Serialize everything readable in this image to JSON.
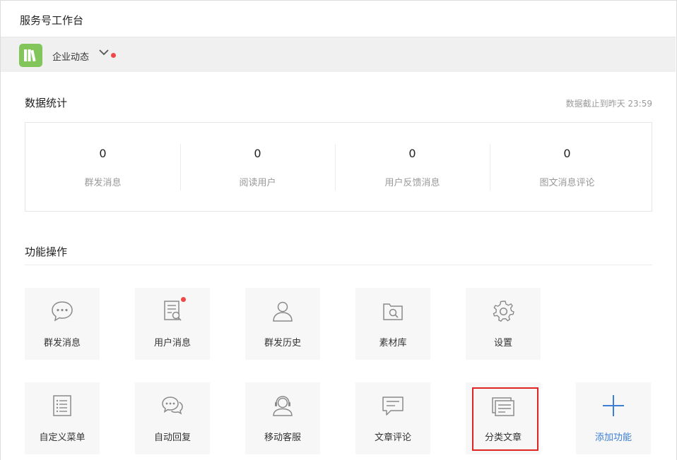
{
  "header": {
    "title": "服务号工作台"
  },
  "account": {
    "name": "企业动态",
    "brand_color": "#82c55b"
  },
  "stats": {
    "title": "数据统计",
    "note": "数据截止到昨天 23:59",
    "items": [
      {
        "value": "0",
        "label": "群发消息"
      },
      {
        "value": "0",
        "label": "阅读用户"
      },
      {
        "value": "0",
        "label": "用户反馈消息"
      },
      {
        "value": "0",
        "label": "图文消息评论"
      }
    ]
  },
  "functions": {
    "title": "功能操作",
    "items": [
      {
        "label": "群发消息",
        "icon": "chat-bubble-icon"
      },
      {
        "label": "用户消息",
        "icon": "document-search-icon",
        "badge": true
      },
      {
        "label": "群发历史",
        "icon": "user-icon"
      },
      {
        "label": "素材库",
        "icon": "folder-search-icon"
      },
      {
        "label": "设置",
        "icon": "gear-icon"
      },
      {
        "label": "自定义菜单",
        "icon": "list-icon"
      },
      {
        "label": "自动回复",
        "icon": "chat-bubbles-icon"
      },
      {
        "label": "移动客服",
        "icon": "headset-user-icon"
      },
      {
        "label": "文章评论",
        "icon": "comment-box-icon"
      },
      {
        "label": "分类文章",
        "icon": "stacked-pages-icon"
      },
      {
        "label": "添加功能",
        "icon": "plus-icon"
      }
    ]
  },
  "colors": {
    "accent": "#3c7fd4",
    "alert": "#f04848",
    "highlight": "#e02424"
  }
}
